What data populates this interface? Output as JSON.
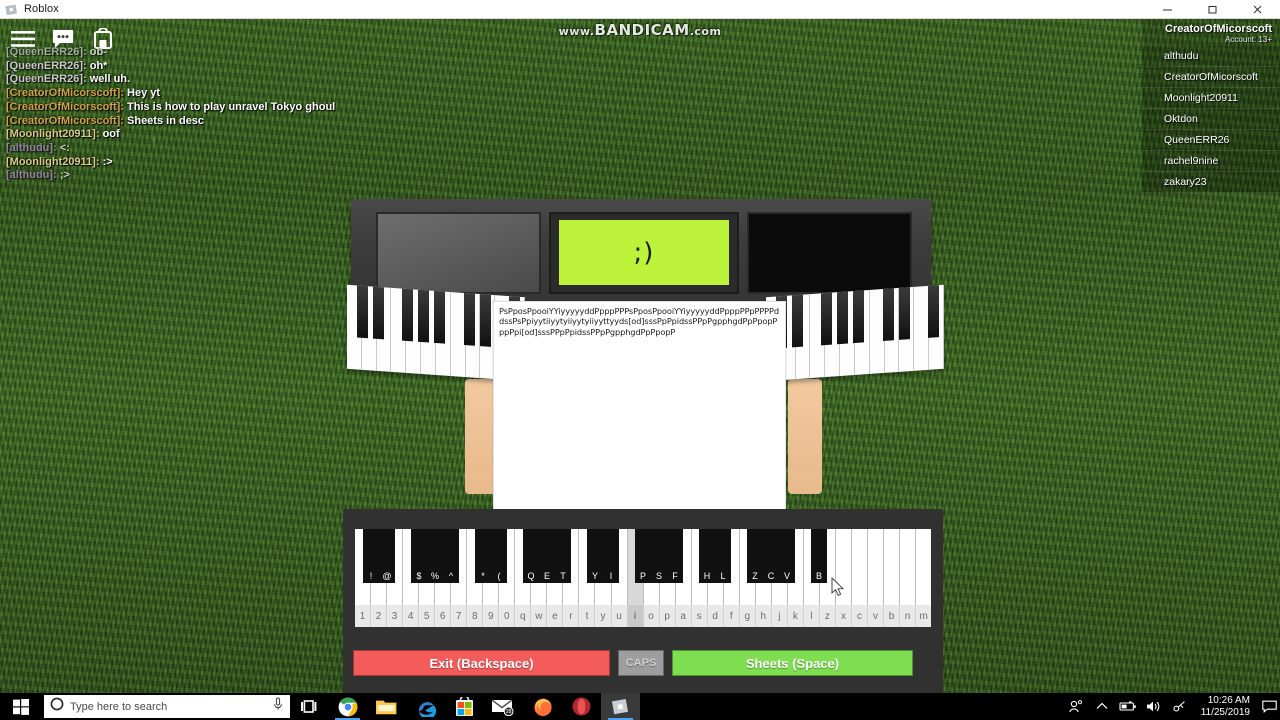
{
  "window": {
    "title": "Roblox",
    "icon": "roblox-icon",
    "minimize_label": "–",
    "maximize_label": "□",
    "close_label": "✕"
  },
  "watermark": {
    "prefix": "www.",
    "brand": "BANDICAM",
    "suffix": ".com"
  },
  "roblox_topbar": {
    "menu_icon": "hamburger-menu-icon",
    "chat_icon": "chat-bubble-icon",
    "backpack_icon": "backpack-icon"
  },
  "chat": {
    "lines": [
      {
        "name": "[QueenERR26]:",
        "message": "ob-",
        "color": "#c9c9c9",
        "faded": true
      },
      {
        "name": "[QueenERR26]:",
        "message": "oh*",
        "color": "#c9c9c9",
        "faded": false
      },
      {
        "name": "[QueenERR26]:",
        "message": "well uh.",
        "color": "#c9c9c9",
        "faded": false
      },
      {
        "name": "[CreatorOfMicorscoft]:",
        "message": "Hey yt",
        "color": "#d2a24c",
        "faded": false
      },
      {
        "name": "[CreatorOfMicorscoft]:",
        "message": "This is how to play unravel Tokyo ghoul",
        "color": "#d2a24c",
        "faded": false
      },
      {
        "name": "[CreatorOfMicorscoft]:",
        "message": "Sheets in desc",
        "color": "#d2a24c",
        "faded": false
      },
      {
        "name": "[Moonlight20911]:",
        "message": "oof",
        "color": "#d8c98a",
        "faded": false
      },
      {
        "name": "[althudu]:",
        "message": "<:",
        "color": "#b58fd0",
        "faded": true
      },
      {
        "name": "[Moonlight20911]:",
        "message": ":>",
        "color": "#d8c98a",
        "faded": false
      },
      {
        "name": "[althudu]:",
        "message": ";>",
        "color": "#b58fd0",
        "faded": true
      }
    ]
  },
  "player_list": {
    "local_player": "CreatorOfMicorscoft",
    "account_label": "Account: 13+",
    "players": [
      "althudu",
      "CreatorOfMicorscoft",
      "Moonlight20911",
      "Oktdon",
      "QueenERR26",
      "rachel9nine",
      "zakary23"
    ]
  },
  "keyboard_model": {
    "display_text": ";)",
    "display_color": "#bdf23a"
  },
  "sheet": {
    "text": "PsPposPpooiYYiyyyyyddPpppPPPsPposPpooiYYiyyyyyddPpppPPpPPPPddssPsPpiyytiiyytyiiyytyiiyyttyyds[od]sssPpPpidssPPpPgpphgdPpPpopPppPpi[od]sssPPpPpidssPPpPgpphgdPpPpopP"
  },
  "piano_gui": {
    "white_key_labels": [
      "1",
      "2",
      "3",
      "4",
      "5",
      "6",
      "7",
      "8",
      "9",
      "0",
      "q",
      "w",
      "e",
      "r",
      "t",
      "y",
      "u",
      "i",
      "o",
      "p",
      "a",
      "s",
      "d",
      "f",
      "g",
      "h",
      "j",
      "k",
      "l",
      "z",
      "x",
      "c",
      "v",
      "b",
      "n",
      "m"
    ],
    "active_white_key": "i",
    "black_key_labels": [
      "!",
      "@",
      "$",
      "%",
      "^",
      "*",
      "(",
      "Q",
      "E",
      "T",
      "Y",
      "I",
      "P",
      "S",
      "F",
      "H",
      "L",
      "Z",
      "C",
      "V",
      "B"
    ],
    "buttons": {
      "exit": "Exit (Backspace)",
      "caps": "CAPS",
      "sheets": "Sheets (Space)"
    },
    "colors": {
      "exit": "#f45b5b",
      "caps": "#9e9e9e",
      "sheets": "#7ede50"
    }
  },
  "taskbar": {
    "start_icon": "windows-start-icon",
    "search_icon": "cortana-circle-icon",
    "search_placeholder": "Type here to search",
    "mic_icon": "microphone-icon",
    "task_view_icon": "task-view-icon",
    "apps": [
      {
        "name": "chrome-taskbar-icon",
        "label": "Google Chrome",
        "badge": ""
      },
      {
        "name": "file-explorer-taskbar-icon",
        "label": "File Explorer",
        "badge": ""
      },
      {
        "name": "edge-taskbar-icon",
        "label": "Microsoft Edge",
        "badge": ""
      },
      {
        "name": "microsoft-store-taskbar-icon",
        "label": "Microsoft Store",
        "badge": ""
      },
      {
        "name": "mail-taskbar-icon",
        "label": "Mail",
        "badge": "28"
      },
      {
        "name": "firefox-taskbar-icon",
        "label": "Mozilla Firefox",
        "badge": ""
      },
      {
        "name": "opera-taskbar-icon",
        "label": "Opera",
        "badge": ""
      },
      {
        "name": "roblox-taskbar-icon",
        "label": "Roblox",
        "badge": ""
      }
    ],
    "tray": [
      "people-icon",
      "show-hidden-icons-chevron",
      "battery-icon",
      "volume-icon",
      "network-icon"
    ],
    "time": "10:26 AM",
    "date": "11/25/2019",
    "notifications_icon": "action-center-icon"
  }
}
